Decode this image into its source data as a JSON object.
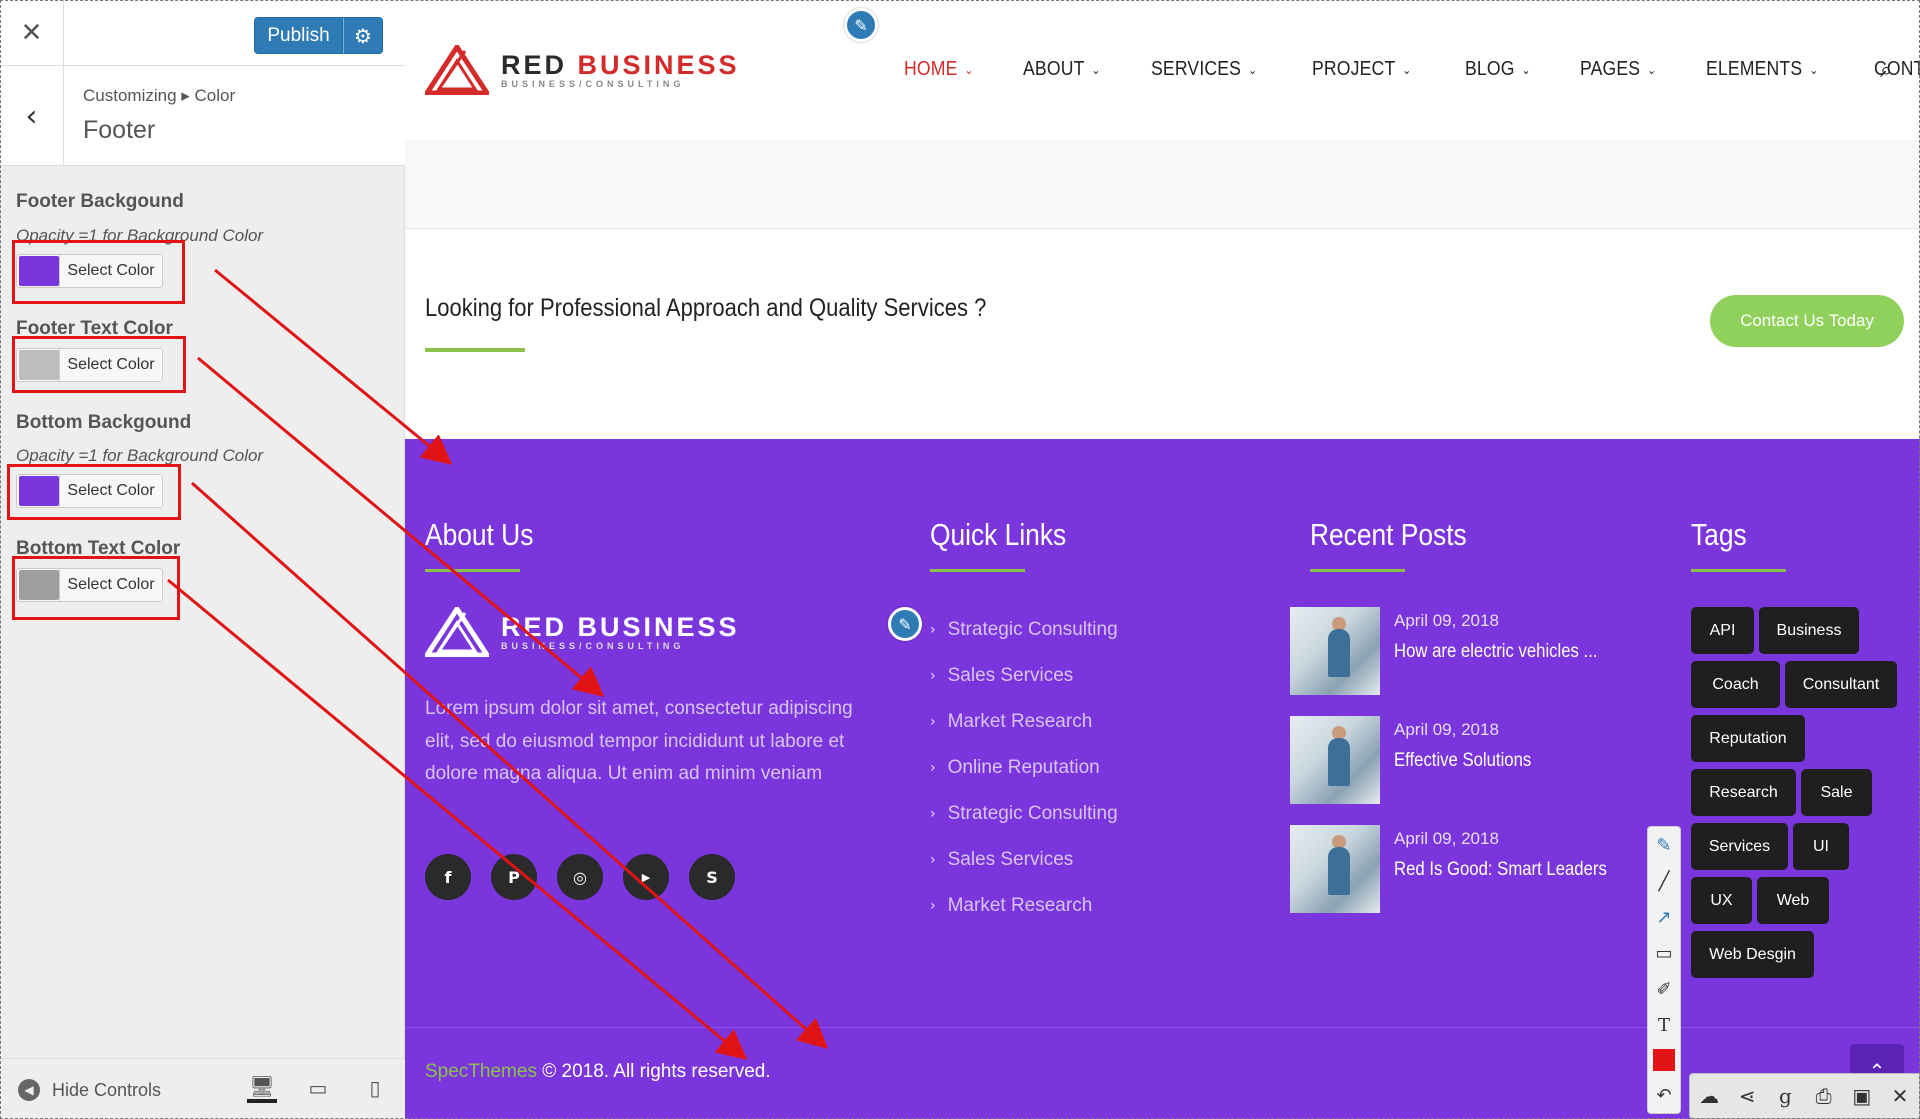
{
  "customizer": {
    "close_icon": "close-icon",
    "publish_label": "Publish",
    "settings_icon": "gear-icon",
    "back_icon": "chevron-left-icon",
    "breadcrumb": "Customizing ▸ Color",
    "section_title": "Footer",
    "controls": [
      {
        "label": "Footer Backgound",
        "description": "Opacity =1 for Background Color",
        "button_label": "Select Color",
        "swatch_color": "#7b35dd"
      },
      {
        "label": "Footer Text Color",
        "description": "",
        "button_label": "Select Color",
        "swatch_color": "#bdbdbd"
      },
      {
        "label": "Bottom Backgound",
        "description": "Opacity =1 for Background Color",
        "button_label": "Select Color",
        "swatch_color": "#7b35dd"
      },
      {
        "label": "Bottom Text Color",
        "description": "",
        "button_label": "Select Color",
        "swatch_color": "#9e9e9e"
      }
    ],
    "hide_controls_label": "Hide Controls",
    "devices": [
      "desktop-icon",
      "tablet-icon",
      "mobile-icon"
    ]
  },
  "site": {
    "logo": {
      "name_part1": "RED",
      "name_part2": "BUSINESS",
      "tagline": "BUSINESS/CONSULTING"
    },
    "nav": [
      {
        "label": "HOME",
        "active": true
      },
      {
        "label": "ABOUT",
        "active": false
      },
      {
        "label": "SERVICES",
        "active": false
      },
      {
        "label": "PROJECT",
        "active": false
      },
      {
        "label": "BLOG",
        "active": false
      },
      {
        "label": "PAGES",
        "active": false
      },
      {
        "label": "ELEMENTS",
        "active": false
      },
      {
        "label": "CONTACT",
        "active": false
      }
    ],
    "search_icon": "search-icon",
    "cta": {
      "text": "Looking for Professional Approach and Quality Services ?",
      "button_label": "Contact Us Today"
    },
    "footer": {
      "about": {
        "heading": "About Us",
        "text": "Lorem ipsum dolor sit amet, consectetur adipiscing elit, sed do eiusmod tempor incididunt ut labore et dolore magna aliqua. Ut enim ad minim veniam",
        "socials": [
          "facebook-icon",
          "pinterest-icon",
          "instagram-icon",
          "youtube-icon",
          "skype-icon"
        ]
      },
      "quick_links": {
        "heading": "Quick Links",
        "items": [
          "Strategic Consulting",
          "Sales Services",
          "Market Research",
          "Online Reputation",
          "Strategic Consulting",
          "Sales Services",
          "Market Research"
        ]
      },
      "recent_posts": {
        "heading": "Recent Posts",
        "items": [
          {
            "date": "April 09, 2018",
            "title": "How are electric vehicles ..."
          },
          {
            "date": "April 09, 2018",
            "title": "Effective Solutions"
          },
          {
            "date": "April 09, 2018",
            "title": "Red Is Good: Smart Leaders"
          }
        ]
      },
      "tags": {
        "heading": "Tags",
        "items": [
          "API",
          "Business",
          "Coach",
          "Consultant",
          "Reputation",
          "Research",
          "Sale",
          "Services",
          "UI",
          "UX",
          "Web",
          "Web Desgin"
        ]
      },
      "copyright_brand": "SpecThemes",
      "copyright_text": "© 2018. All rights reserved."
    }
  },
  "colors": {
    "footer_bg": "#7b35dd",
    "accent_green": "#8bc34a",
    "brand_red": "#d42a2a",
    "publish_blue": "#2e7bb6",
    "annotation_red": "#e01414"
  }
}
